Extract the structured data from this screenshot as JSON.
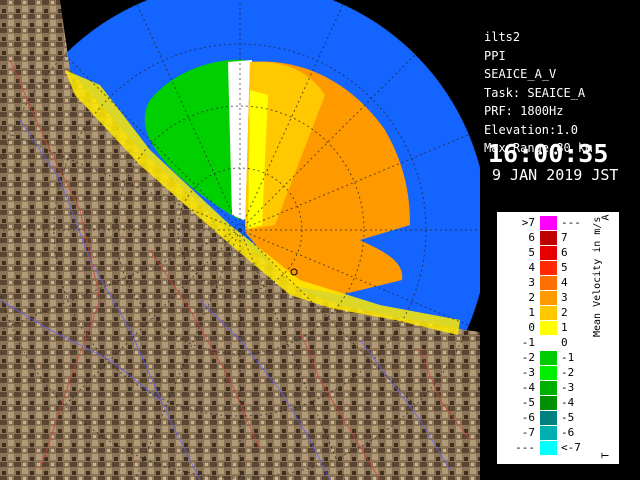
{
  "info": {
    "site": "ilts2",
    "mode": "PPI",
    "product": "SEAICE_A_V",
    "task": "Task: SEAICE_A",
    "prf": "PRF: 1800Hz",
    "elevation": "Elevation:1.0",
    "max_range": "Max Range:80 km",
    "time": "16:00:35",
    "date": "9 JAN 2019 JST"
  },
  "legend": {
    "title": "Mean Velocity in m/s",
    "top_glyph": "A",
    "bottom_glyph": "T",
    "rows": [
      {
        "left": ">7",
        "right": "---",
        "color": "#ff00ff"
      },
      {
        "left": "6",
        "right": "7",
        "color": "#c00000"
      },
      {
        "left": "5",
        "right": "6",
        "color": "#e80000"
      },
      {
        "left": "4",
        "right": "5",
        "color": "#ff2800"
      },
      {
        "left": "3",
        "right": "4",
        "color": "#ff7000"
      },
      {
        "left": "2",
        "right": "3",
        "color": "#ff9900"
      },
      {
        "left": "1",
        "right": "2",
        "color": "#ffc800"
      },
      {
        "left": "0",
        "right": "1",
        "color": "#ffff00"
      },
      {
        "left": "-1",
        "right": "0",
        "color": "#ffffff"
      },
      {
        "left": "-2",
        "right": "-1",
        "color": "#00cc00"
      },
      {
        "left": "-3",
        "right": "-2",
        "color": "#00ee00"
      },
      {
        "left": "-4",
        "right": "-3",
        "color": "#00b000"
      },
      {
        "left": "-5",
        "right": "-4",
        "color": "#009000"
      },
      {
        "left": "-6",
        "right": "-5",
        "color": "#008080"
      },
      {
        "left": "-7",
        "right": "-6",
        "color": "#00b0b0"
      },
      {
        "left": "---",
        "right": "<-7",
        "color": "#00ffff"
      }
    ]
  },
  "colors": {
    "sea": "#1464ff",
    "land": "#8c7456",
    "outside": "#000000"
  }
}
